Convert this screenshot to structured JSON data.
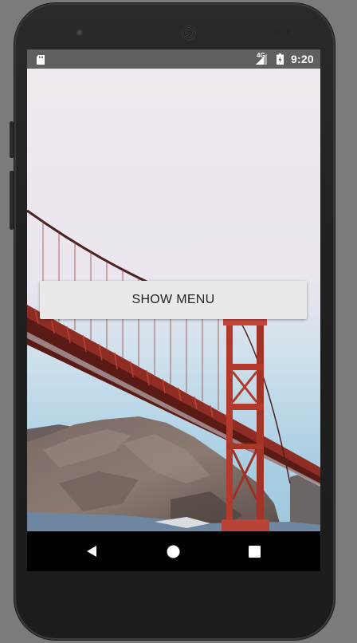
{
  "status_bar": {
    "network_type": "4G",
    "time": "9:20",
    "icons": [
      "sd-card-icon",
      "signal-icon",
      "battery-icon"
    ]
  },
  "main": {
    "show_menu_button": "SHOW MENU"
  },
  "nav_bar": {
    "icons": [
      "back-icon",
      "home-icon",
      "recents-icon"
    ]
  },
  "colors": {
    "status_bar": "#5f5f5f",
    "nav_bar": "#000000",
    "button_bg": "#e9e9e9",
    "bridge": "#b2392c",
    "sky": "#f0e8ef"
  }
}
